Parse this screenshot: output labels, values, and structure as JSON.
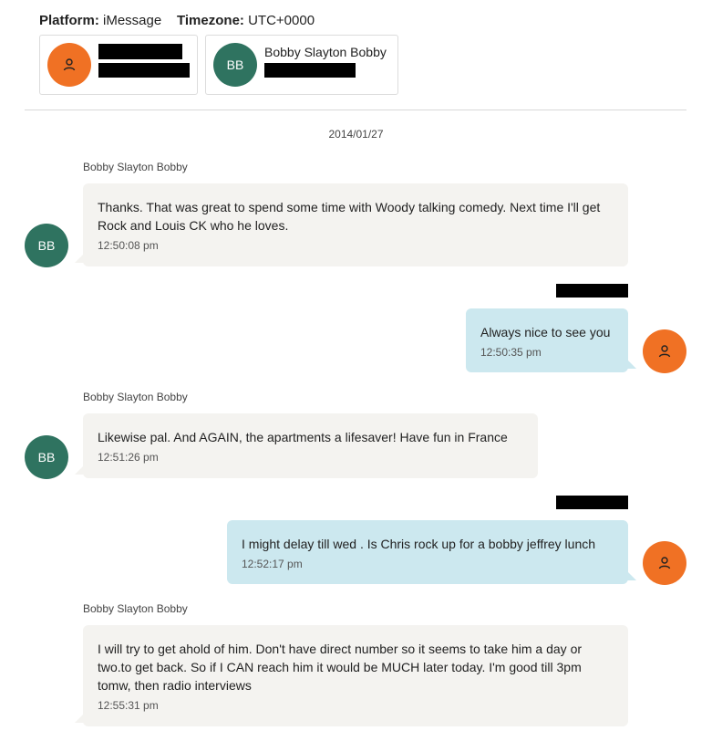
{
  "header": {
    "platform_label": "Platform:",
    "platform_value": "iMessage",
    "timezone_label": "Timezone:",
    "timezone_value": "UTC+0000"
  },
  "participants": [
    {
      "initials": "",
      "icon": "person-icon",
      "name": "",
      "color": "#f07124"
    },
    {
      "initials": "BB",
      "name": "Bobby Slayton Bobby",
      "color": "#2f7360"
    }
  ],
  "conversation": {
    "date": "2014/01/27",
    "messages": [
      {
        "direction": "incoming",
        "sender": "Bobby Slayton Bobby",
        "initials": "BB",
        "text": "Thanks. That was great to spend some time with Woody talking comedy. Next time I'll get Rock and Louis CK who he loves.",
        "time": "12:50:08 pm"
      },
      {
        "direction": "outgoing",
        "sender": "",
        "icon": "person-icon",
        "text": "Always nice to see you",
        "time": "12:50:35 pm"
      },
      {
        "direction": "incoming",
        "sender": "Bobby Slayton Bobby",
        "initials": "BB",
        "text": "Likewise pal. And AGAIN, the apartments a lifesaver! Have fun in France",
        "time": "12:51:26 pm"
      },
      {
        "direction": "outgoing",
        "sender": "",
        "icon": "person-icon",
        "text": "I might delay till wed . Is Chris rock up for a bobby jeffrey lunch",
        "time": "12:52:17 pm"
      },
      {
        "direction": "incoming",
        "sender": "Bobby Slayton Bobby",
        "initials": "BB",
        "text": "I will try to get ahold of him. Don't have direct number so it seems to take him a day or two.to get back. So if I CAN reach him it would be MUCH later today. I'm good till 3pm tomw, then radio interviews",
        "time": "12:55:31 pm"
      }
    ]
  }
}
